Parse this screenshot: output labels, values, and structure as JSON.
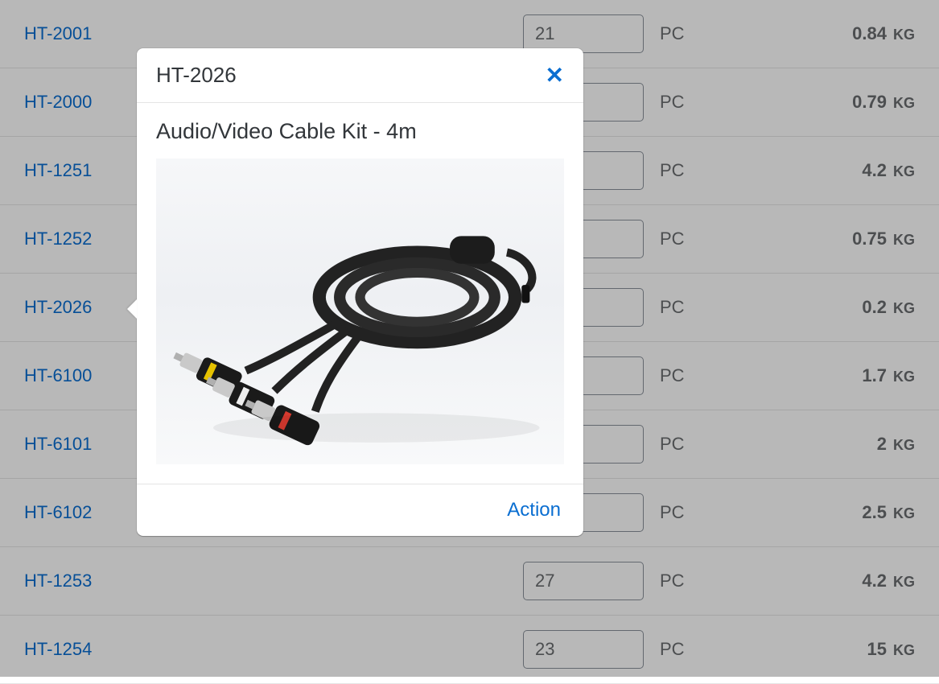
{
  "rows": [
    {
      "id": "HT-2001",
      "qty": "21",
      "unit": "PC",
      "weight": "0.84",
      "wunit": "KG"
    },
    {
      "id": "HT-2000",
      "qty": "",
      "unit": "PC",
      "weight": "0.79",
      "wunit": "KG"
    },
    {
      "id": "HT-1251",
      "qty": "",
      "unit": "PC",
      "weight": "4.2",
      "wunit": "KG"
    },
    {
      "id": "HT-1252",
      "qty": "",
      "unit": "PC",
      "weight": "0.75",
      "wunit": "KG"
    },
    {
      "id": "HT-2026",
      "qty": "",
      "unit": "PC",
      "weight": "0.2",
      "wunit": "KG"
    },
    {
      "id": "HT-6100",
      "qty": "",
      "unit": "PC",
      "weight": "1.7",
      "wunit": "KG"
    },
    {
      "id": "HT-6101",
      "qty": "",
      "unit": "PC",
      "weight": "2",
      "wunit": "KG"
    },
    {
      "id": "HT-6102",
      "qty": "",
      "unit": "PC",
      "weight": "2.5",
      "wunit": "KG"
    },
    {
      "id": "HT-1253",
      "qty": "27",
      "unit": "PC",
      "weight": "4.2",
      "wunit": "KG"
    },
    {
      "id": "HT-1254",
      "qty": "23",
      "unit": "PC",
      "weight": "15",
      "wunit": "KG"
    }
  ],
  "popover": {
    "title": "HT-2026",
    "description": "Audio/Video Cable Kit - 4m",
    "action_label": "Action",
    "close_label": "✕"
  }
}
